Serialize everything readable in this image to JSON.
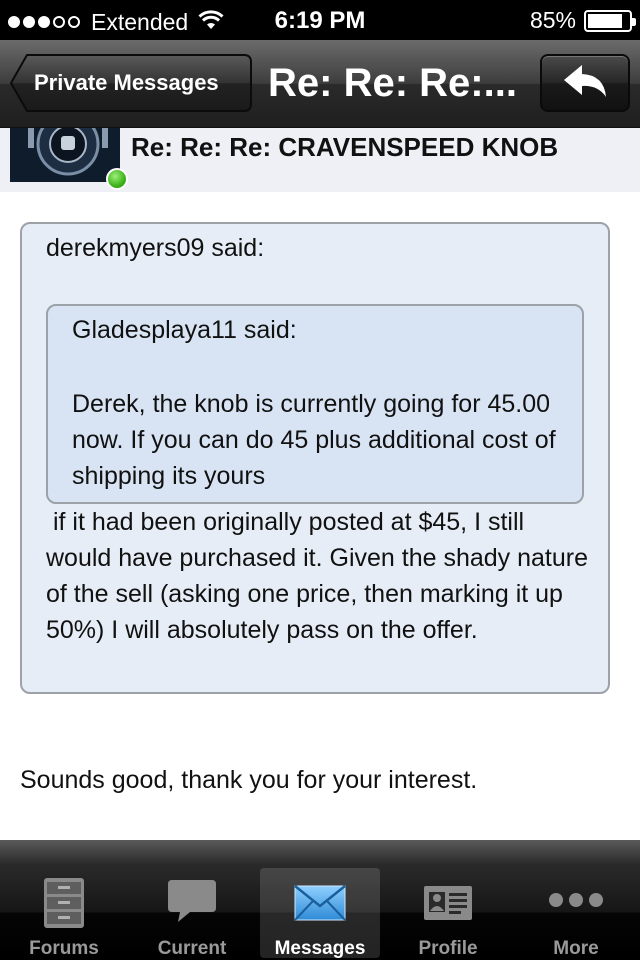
{
  "status_bar": {
    "signal_bars_filled": 3,
    "carrier": "Extended",
    "time": "6:19 PM",
    "battery_percent_label": "85%",
    "battery_level": 0.85
  },
  "nav": {
    "back_label": "Private Messages",
    "title": "Re: Re: Re:...",
    "reply_icon": "reply-arrow-icon"
  },
  "thread": {
    "title": "Re: Re: Re: CRAVENSPEED KNOB",
    "online_status_color": "#3db31a"
  },
  "message": {
    "outer_quote": {
      "author": "derekmyers09 said:",
      "body": " if it had been originally posted at $45, I still would have purchased it. Given the shady nature of the sell (asking one price, then marking it up 50%) I will absolutely pass on the offer."
    },
    "inner_quote": {
      "author": "Gladesplaya11 said:",
      "body": "Derek, the knob is currently going for 45.00 now. If you can do 45 plus additional cost of shipping its yours"
    },
    "reply": "Sounds good, thank you for your interest."
  },
  "tabs": [
    {
      "label": "Forums",
      "icon": "file-cabinet-icon",
      "active": false
    },
    {
      "label": "Current",
      "icon": "speech-bubble-icon",
      "active": false
    },
    {
      "label": "Messages",
      "icon": "envelope-icon",
      "active": true
    },
    {
      "label": "Profile",
      "icon": "id-card-icon",
      "active": false
    },
    {
      "label": "More",
      "icon": "more-dots-icon",
      "active": false
    }
  ],
  "colors": {
    "quote_outer_bg": "#e6edf6",
    "quote_inner_bg": "#d8e4f3",
    "quote_border": "#9da2a8",
    "active_tab_icon": "#4aa3e8"
  }
}
